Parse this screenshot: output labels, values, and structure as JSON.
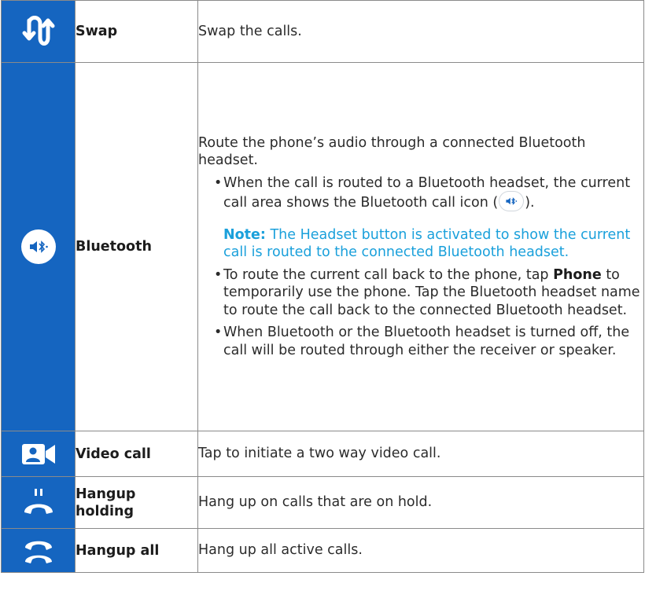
{
  "rows": [
    {
      "icon": "swap-arrows-icon",
      "name": "Swap",
      "description": "Swap the calls."
    },
    {
      "icon": "bluetooth-headset-icon",
      "name": "Bluetooth",
      "intro": "Route the phone’s audio through a connected Bluetooth headset.",
      "bullet1_before": "When the call is routed to a Bluetooth headset, the current call area shows the Bluetooth call icon (",
      "bullet1_after": ").",
      "note_label": "Note:",
      "note_text": " The Headset button is activated to show the current call is routed to the connected Bluetooth headset.",
      "bullet2_before": "To route the current call back to the phone, tap ",
      "bullet2_bold": "Phone",
      "bullet2_after": " to temporarily use the phone. Tap the Bluetooth headset name to route the call back to the connected Bluetooth headset.",
      "bullet3": "When Bluetooth or the Bluetooth headset is turned off, the call will be routed through either the receiver or speaker."
    },
    {
      "icon": "video-camera-icon",
      "name": "Video call",
      "description": "Tap to initiate a two way video call."
    },
    {
      "icon": "hangup-holding-icon",
      "name": "Hangup holding",
      "description": "Hang up on calls that are on hold."
    },
    {
      "icon": "hangup-all-icon",
      "name": "Hangup all",
      "description": "Hang up all active calls."
    }
  ],
  "bullet_char": "•",
  "colors": {
    "icon_cell_bg": "#1565c0",
    "note_text": "#1aa0db",
    "border": "#8a8a8a",
    "body_text": "#2b2b2b"
  }
}
